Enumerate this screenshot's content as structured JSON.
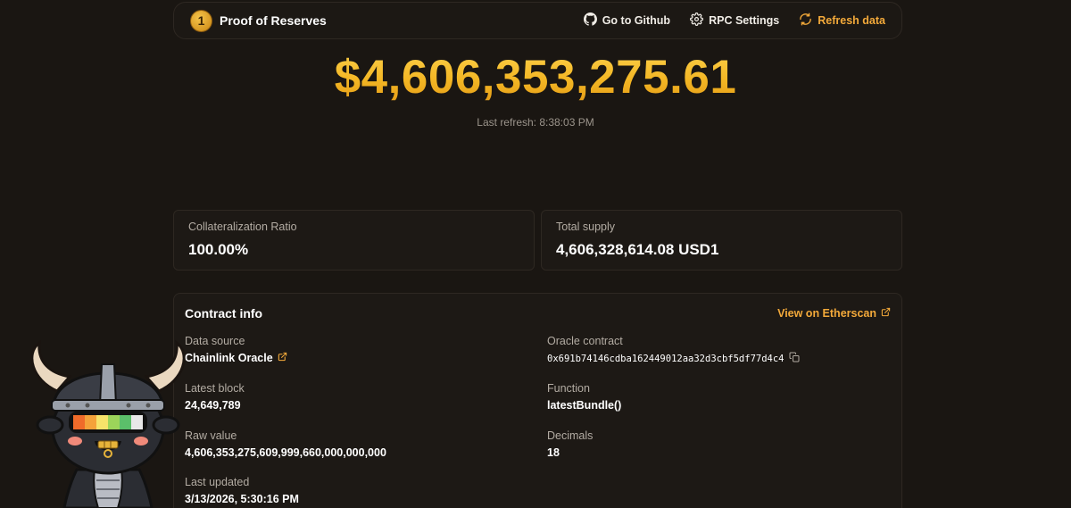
{
  "nav": {
    "brand_badge": "1",
    "brand_title": "Proof of Reserves",
    "github_label": "Go to Github",
    "rpc_label": "RPC Settings",
    "refresh_label": "Refresh data"
  },
  "hero": {
    "amount": "$4,606,353,275.61",
    "last_refresh": "Last refresh: 8:38:03 PM"
  },
  "stats": {
    "collateral_label": "Collateralization Ratio",
    "collateral_value": "100.00%",
    "supply_label": "Total supply",
    "supply_value": "4,606,328,614.08 USD1"
  },
  "contract": {
    "title": "Contract info",
    "etherscan_label": "View on Etherscan",
    "data_source_label": "Data source",
    "data_source_value": "Chainlink Oracle",
    "oracle_label": "Oracle contract",
    "oracle_value": "0x691b74146cdba162449012aa32d3cbf5df77d4c4",
    "latest_block_label": "Latest block",
    "latest_block_value": "24,649,789",
    "function_label": "Function",
    "function_value": "latestBundle()",
    "raw_value_label": "Raw value",
    "raw_value_value": "4,606,353,275,609,999,660,000,000,000",
    "decimals_label": "Decimals",
    "decimals_value": "18",
    "last_updated_label": "Last updated",
    "last_updated_value": "3/13/2026, 5:30:16 PM"
  },
  "colors": {
    "background": "#1a1612",
    "accent": "#f3a93a",
    "hero_gold": "#f3b624",
    "card_border": "#2e2822"
  },
  "icons": {
    "brand": "coin-icon",
    "github": "github-icon",
    "rpc": "gear-icon",
    "refresh": "refresh-icon",
    "external": "external-link-icon",
    "copy": "copy-icon",
    "mascot": "bull-mascot-illustration"
  }
}
